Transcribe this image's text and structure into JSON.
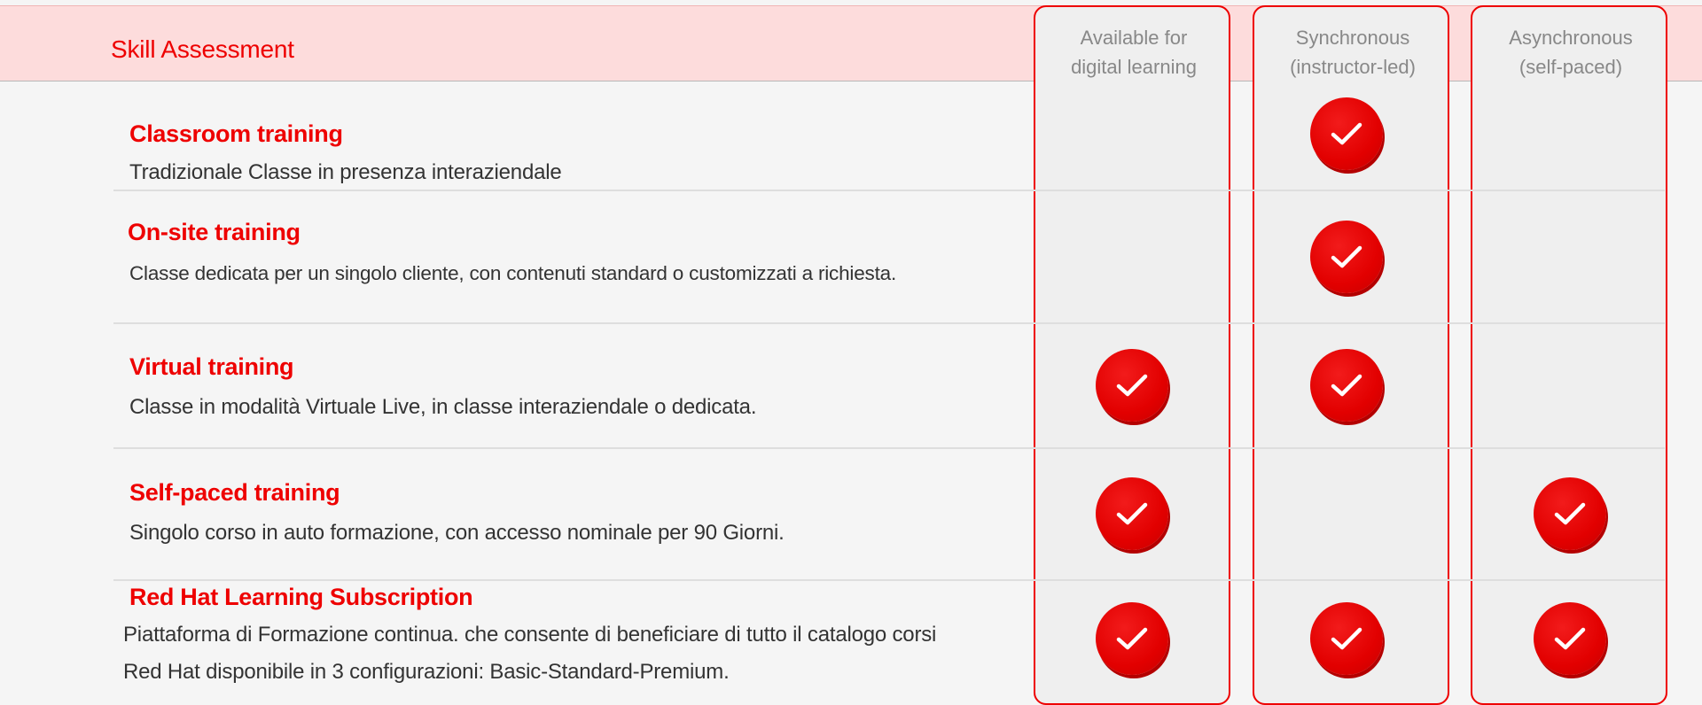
{
  "header": {
    "title": "Skill Assessment"
  },
  "columns": [
    {
      "label": "Available for\ndigital learning"
    },
    {
      "label": "Synchronous\n(instructor-led)"
    },
    {
      "label": "Asynchronous\n(self-paced)"
    }
  ],
  "rows": [
    {
      "title": "Classroom training",
      "desc": "Tradizionale Classe in presenza interaziendale",
      "checks": [
        false,
        true,
        false
      ]
    },
    {
      "title": "On-site training",
      "desc": "Classe dedicata per un singolo cliente, con contenuti standard o customizzati a richiesta.",
      "checks": [
        false,
        true,
        false
      ]
    },
    {
      "title": "Virtual training",
      "desc": "Classe in modalità Virtuale Live, in classe interaziendale o dedicata.",
      "checks": [
        true,
        true,
        false
      ]
    },
    {
      "title": "Self-paced training",
      "desc": "Singolo corso in auto formazione, con accesso nominale per 90 Giorni.",
      "checks": [
        true,
        false,
        true
      ]
    },
    {
      "title": "Red Hat Learning Subscription",
      "desc": "Piattaforma di Formazione continua.  che consente di beneficiare di tutto il catalogo corsi\nRed Hat disponibile in 3 configurazioni: Basic-Standard-Premium.",
      "checks": [
        true,
        true,
        true
      ]
    }
  ],
  "icons": {
    "check": "check-circle-icon"
  },
  "colors": {
    "accent": "#ee0000",
    "header_bg": "#fddcdc",
    "column_bg": "#efefef"
  }
}
